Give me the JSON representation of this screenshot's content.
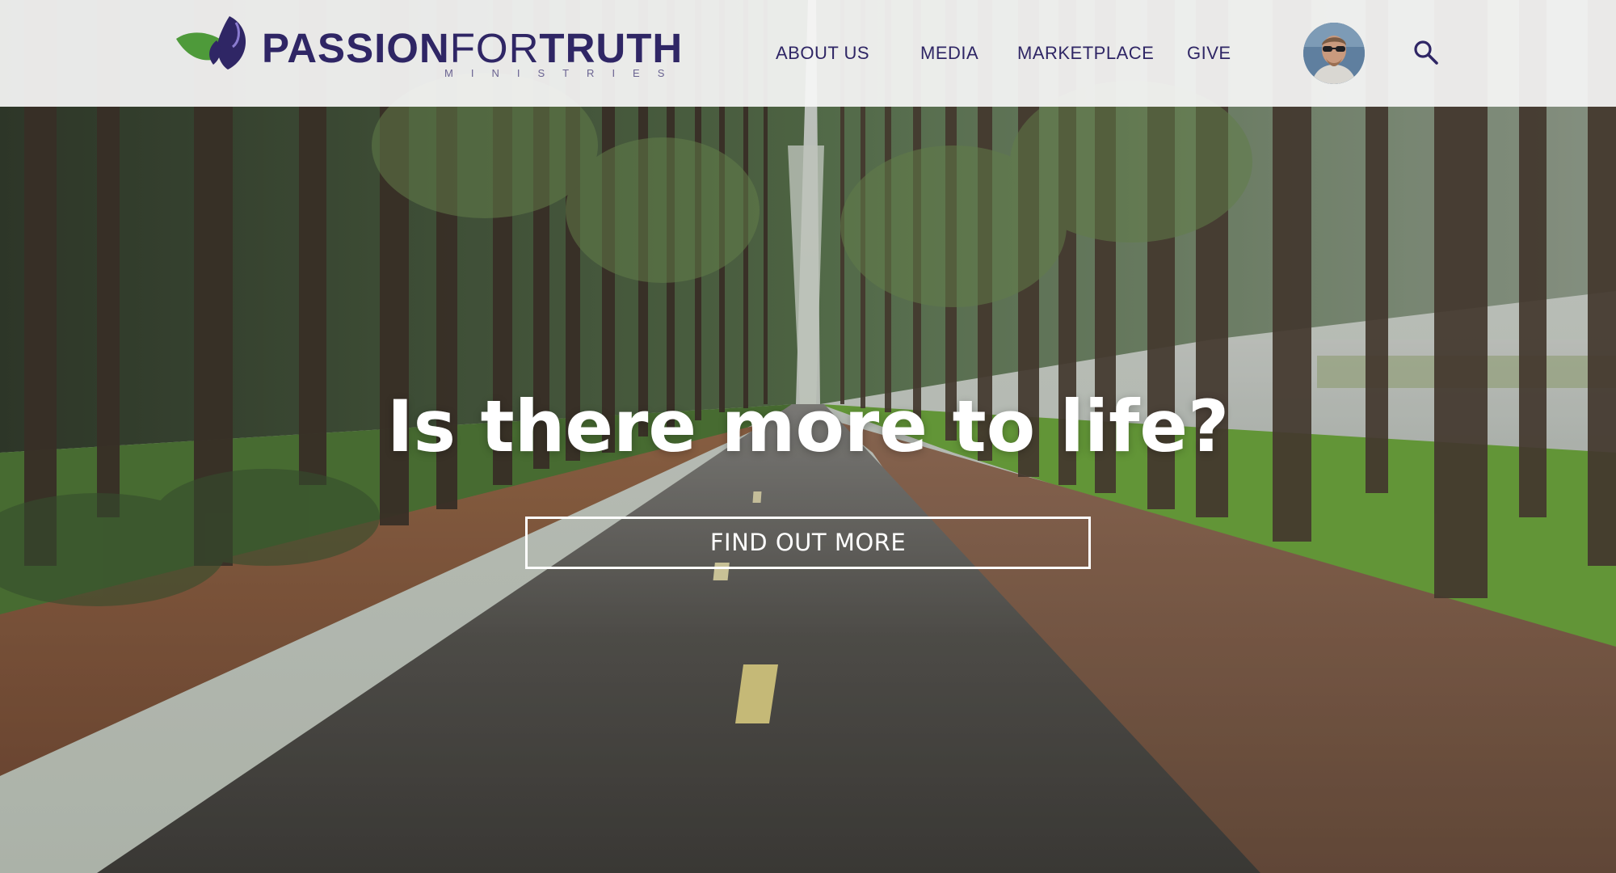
{
  "header": {
    "logo": {
      "name_part1": "PASSION",
      "name_part2": "FOR",
      "name_part3": "TRUTH",
      "subtitle": "MINISTRIES",
      "colors": {
        "navy": "#2f2665",
        "leaf_green": "#4e9a3a",
        "leaf_purple": "#2f2665"
      }
    },
    "nav": {
      "about": "ABOUT US",
      "media": "MEDIA",
      "marketplace": "MARKETPLACE",
      "give": "GIVE"
    },
    "icons": {
      "search": "search-icon",
      "avatar": "user-avatar"
    }
  },
  "hero": {
    "headline": "Is there more to life?",
    "cta_label": "FIND OUT MORE",
    "background": "forest-road-photo"
  }
}
